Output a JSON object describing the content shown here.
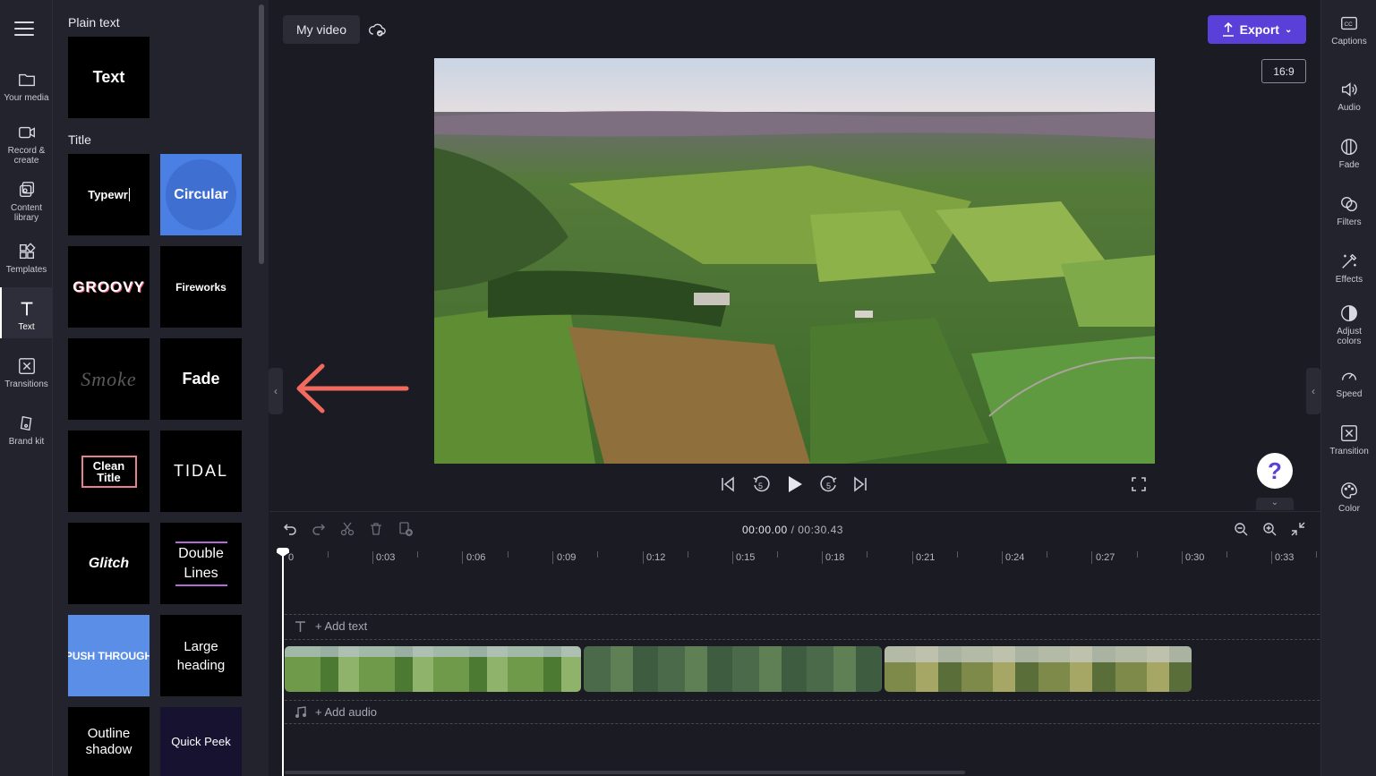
{
  "rail": {
    "items": [
      {
        "label": "Your media",
        "icon": "folder-icon"
      },
      {
        "label": "Record & create",
        "icon": "camera-icon"
      },
      {
        "label": "Content library",
        "icon": "library-icon"
      },
      {
        "label": "Templates",
        "icon": "templates-icon"
      },
      {
        "label": "Text",
        "icon": "text-icon"
      },
      {
        "label": "Transitions",
        "icon": "transitions-icon"
      },
      {
        "label": "Brand kit",
        "icon": "brand-kit-icon"
      }
    ]
  },
  "panel": {
    "plain_heading": "Plain text",
    "plain_tile": "Text",
    "title_heading": "Title",
    "tiles": [
      "Typewr",
      "Circular",
      "GROOVY",
      "Fireworks",
      "Smoke",
      "Fade",
      "Clean Title",
      "TIDAL",
      "Glitch",
      "Double Lines",
      "PUSH THROUGH",
      "Large heading",
      "Outline shadow",
      "Quick Peek"
    ]
  },
  "header": {
    "project_title": "My video",
    "export_label": "Export",
    "aspect_ratio": "16:9"
  },
  "right_rail": {
    "items": [
      {
        "label": "Captions",
        "icon": "captions-icon"
      },
      {
        "label": "Audio",
        "icon": "speaker-icon"
      },
      {
        "label": "Fade",
        "icon": "fade-icon"
      },
      {
        "label": "Filters",
        "icon": "filters-icon"
      },
      {
        "label": "Effects",
        "icon": "magic-wand-icon"
      },
      {
        "label": "Adjust colors",
        "icon": "adjust-colors-icon"
      },
      {
        "label": "Speed",
        "icon": "speedometer-icon"
      },
      {
        "label": "Transition",
        "icon": "transition-icon"
      },
      {
        "label": "Color",
        "icon": "palette-icon"
      }
    ]
  },
  "player": {
    "help_label": "?"
  },
  "timeline": {
    "current_time": "00:00.00",
    "total_time": "/ 00:30.43",
    "ruler": [
      "0",
      "0:03",
      "0:06",
      "0:09",
      "0:12",
      "0:15",
      "0:18",
      "0:21",
      "0:24",
      "0:27",
      "0:30",
      "0:33"
    ],
    "add_text": "+ Add text",
    "add_audio": "+ Add audio"
  },
  "colors": {
    "accent": "#5b3fd9",
    "arrow": "#f26a5e",
    "background": "#1b1b24",
    "panel": "#23232d"
  }
}
